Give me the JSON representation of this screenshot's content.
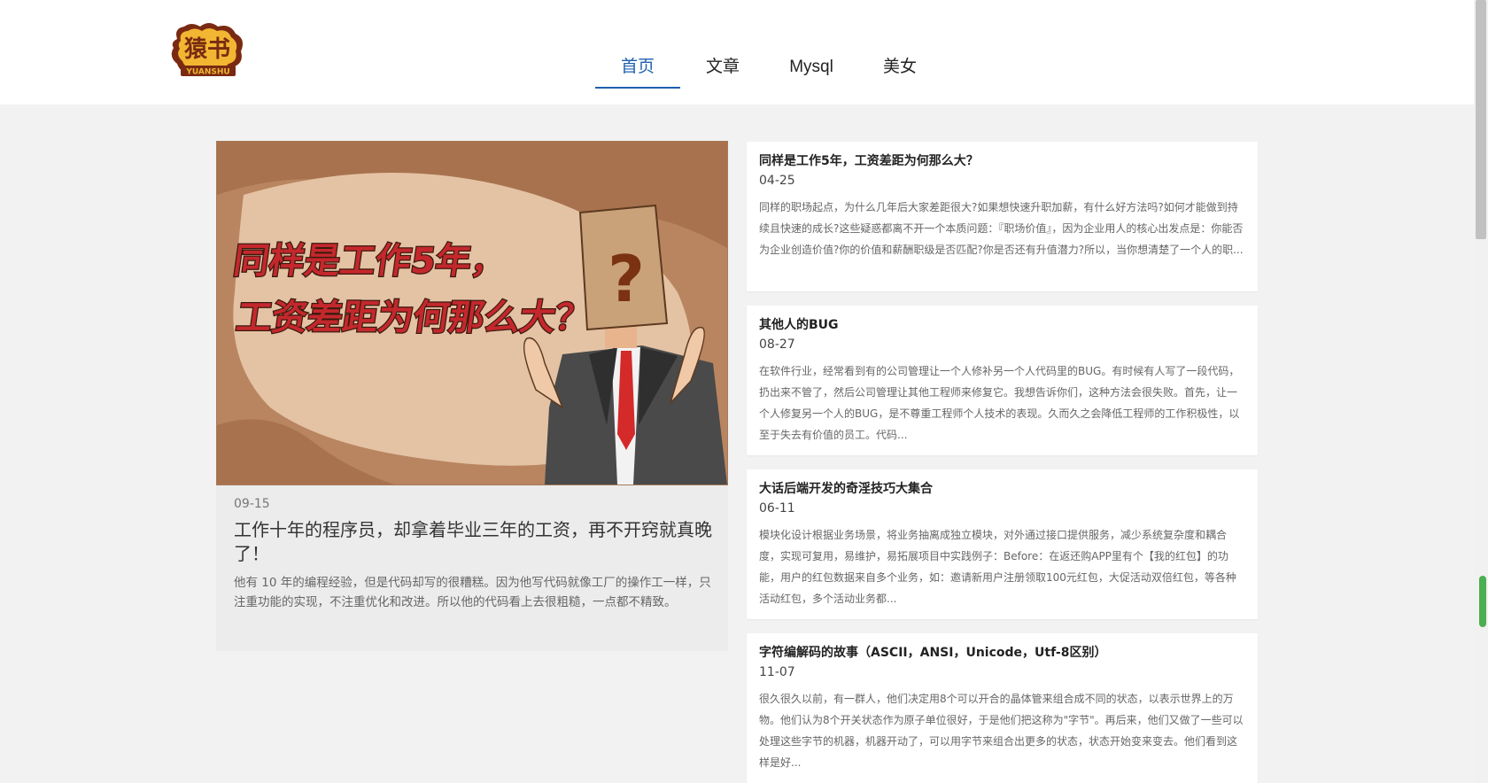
{
  "header": {
    "logo": {
      "main_text": "猿书",
      "sub_text": "YUANSHU"
    },
    "nav": [
      {
        "label": "首页",
        "active": true
      },
      {
        "label": "文章",
        "active": false
      },
      {
        "label": "Mysql",
        "active": false
      },
      {
        "label": "美女",
        "active": false
      }
    ]
  },
  "featured": {
    "image_text": {
      "line1": "同样是工作5年，",
      "line2": "工资差距为何那么大？"
    },
    "date": "09-15",
    "title": "工作十年的程序员，却拿着毕业三年的工资，再不开窍就真晚了！",
    "summary": "他有 10 年的编程经验，但是代码却写的很糟糕。因为他写代码就像工厂的操作工一样，只注重功能的实现，不注重优化和改进。所以他的代码看上去很粗糙，一点都不精致。"
  },
  "articles": [
    {
      "title": "同样是工作5年，工资差距为何那么大？",
      "date": "04-25",
      "summary": "同样的职场起点，为什么几年后大家差距很大?如果想快速升职加薪，有什么好方法吗?如何才能做到持续且快速的成长?这些疑惑都离不开一个本质问题：『职场价值』，因为企业用人的核心出发点是：你能否为企业创造价值?你的价值和薪酬职级是否匹配?你是否还有升值潜力?所以，当你想清楚了一个人的职..."
    },
    {
      "title": "其他人的BUG",
      "date": "08-27",
      "summary": "在软件行业，经常看到有的公司管理让一个人修补另一个人代码里的BUG。有时候有人写了一段代码，扔出来不管了，然后公司管理让其他工程师来修复它。我想告诉你们，这种方法会很失败。首先，让一个人修复另一个人的BUG，是不尊重工程师个人技术的表现。久而久之会降低工程师的工作积极性，以至于失去有价值的员工。代码..."
    },
    {
      "title": "大话后端开发的奇淫技巧大集合",
      "date": "06-11",
      "summary": "模块化设计根据业务场景，将业务抽离成独立模块，对外通过接口提供服务，减少系统复杂度和耦合度，实现可复用，易维护，易拓展项目中实践例子：Before：在返还购APP里有个【我的红包】的功能，用户的红包数据来自多个业务，如：邀请新用户注册领取100元红包，大促活动双倍红包，等各种活动红包，多个活动业务都..."
    },
    {
      "title": "字符编解码的故事（ASCII，ANSI，Unicode，Utf-8区别）",
      "date": "11-07",
      "summary": "很久很久以前，有一群人，他们决定用8个可以开合的晶体管来组合成不同的状态，以表示世界上的万物。他们认为8个开关状态作为原子单位很好，于是他们把这称为\"字节\"。再后来，他们又做了一些可以处理这些字节的机器，机器开动了，可以用字节来组合出更多的状态，状态开始变来变去。他们看到这样是好..."
    }
  ]
}
